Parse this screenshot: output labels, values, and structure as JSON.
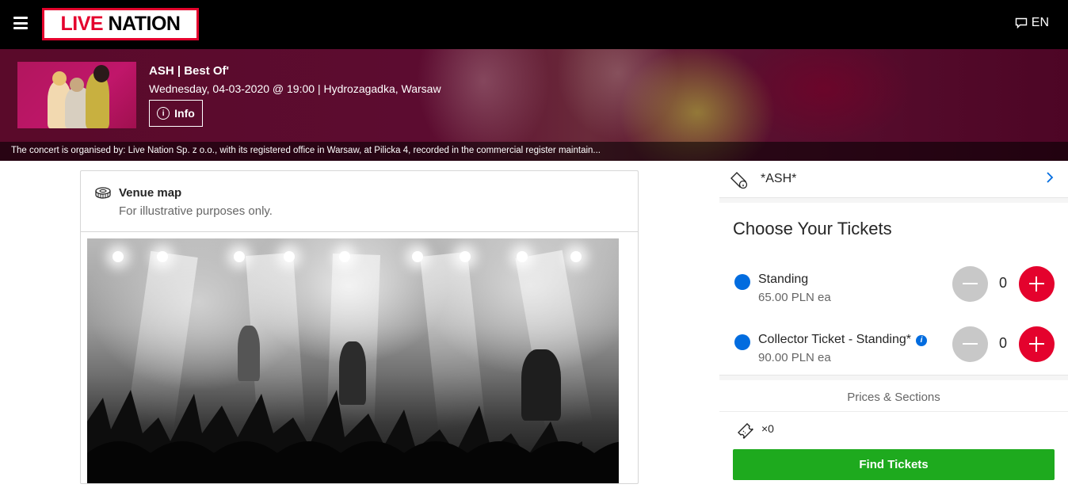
{
  "nav": {
    "logo_text_live": "LIVE",
    "logo_text_nation": "NATION",
    "language": "EN"
  },
  "event": {
    "title": "ASH | Best Of'",
    "details": "Wednesday, 04-03-2020 @ 19:00 | Hydrozagadka, Warsaw",
    "info_label": "Info",
    "organiser_notice": "The concert is organised by: Live Nation Sp. z o.o., with its registered office in Warsaw, at Pilicka 4, recorded in the commercial register maintain..."
  },
  "venue": {
    "title": "Venue map",
    "note": "For illustrative purposes only."
  },
  "panel": {
    "filter_label": "*ASH*",
    "heading": "Choose Your Tickets",
    "tiers": [
      {
        "name": "Standing",
        "price": "65.00 PLN ea",
        "qty": "0",
        "color": "#026cdf",
        "has_info": false
      },
      {
        "name": "Collector Ticket - Standing*",
        "price": "90.00 PLN ea",
        "qty": "0",
        "color": "#026cdf",
        "has_info": true
      }
    ],
    "prices_sections": "Prices & Sections",
    "ticket_count": "×0",
    "find_button": "Find Tickets"
  },
  "colors": {
    "brand_red": "#e4022d",
    "accent_blue": "#026cdf",
    "cta_green": "#1eaa1e"
  },
  "icons": [
    "menu-icon",
    "chat-bubble-icon",
    "info-icon",
    "stadium-icon",
    "ticket-filter-icon",
    "chevron-right-icon",
    "ticket-icon"
  ]
}
